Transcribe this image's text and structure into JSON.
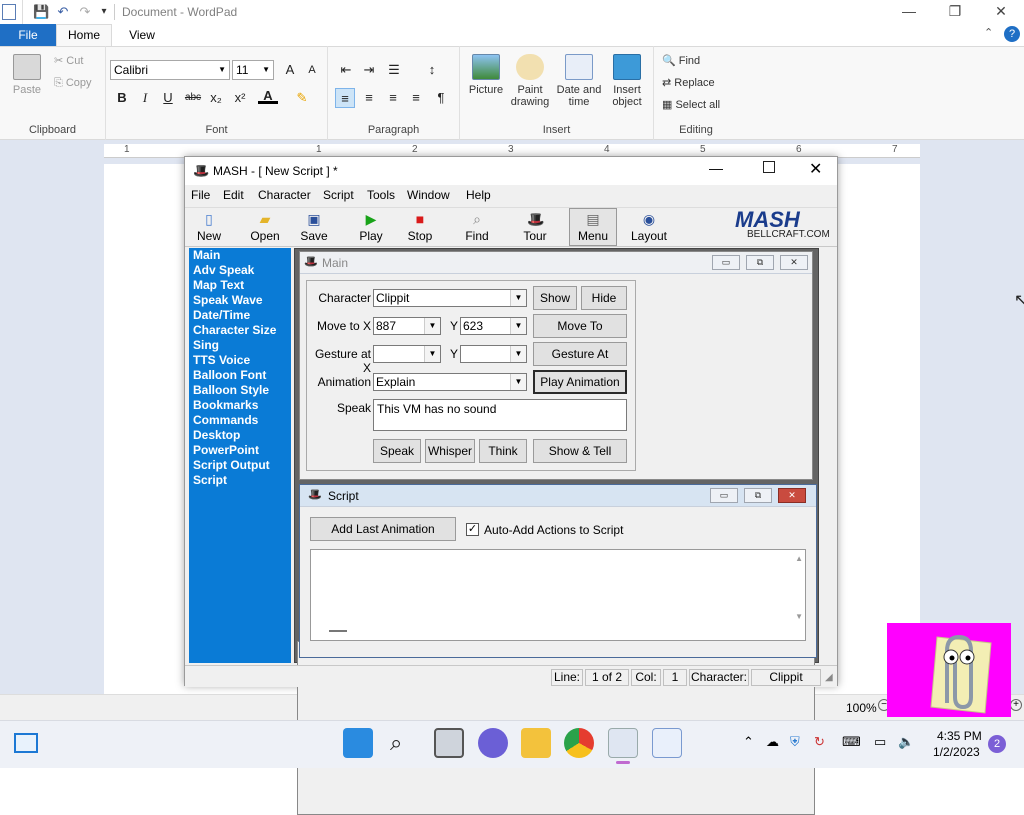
{
  "wordpad": {
    "title": "Document - WordPad",
    "tabs": {
      "file": "File",
      "home": "Home",
      "view": "View"
    },
    "clipboard": {
      "paste": "Paste",
      "cut": "Cut",
      "copy": "Copy",
      "group": "Clipboard"
    },
    "font": {
      "family": "Calibri",
      "size": "11",
      "group": "Font",
      "bold": "B",
      "italic": "I",
      "underline": "U",
      "strike": "abc",
      "sub": "x₂",
      "sup": "x²",
      "color": "A"
    },
    "paragraph": {
      "group": "Paragraph"
    },
    "insert": {
      "picture": "Picture",
      "paint": "Paint drawing",
      "datetime": "Date and time",
      "object": "Insert object",
      "group": "Insert"
    },
    "editing": {
      "find": "Find",
      "replace": "Replace",
      "select_all": "Select all",
      "group": "Editing"
    },
    "ruler": [
      "1",
      "1",
      "2",
      "3",
      "4",
      "5",
      "6",
      "7"
    ],
    "zoom": "100%"
  },
  "mash": {
    "title": "MASH - [ New Script ] *",
    "menu": [
      "File",
      "Edit",
      "Character",
      "Script",
      "Tools",
      "Window",
      "Help"
    ],
    "toolbar": {
      "new": "New",
      "open": "Open",
      "save": "Save",
      "play": "Play",
      "stop": "Stop",
      "find": "Find",
      "tour": "Tour",
      "menu": "Menu",
      "layout": "Layout"
    },
    "brand": "MASH",
    "brand_url": "BELLCRAFT.COM",
    "sidebar": [
      "Main",
      "Adv Speak",
      "Map Text",
      "Speak Wave",
      "Date/Time",
      "Character Size",
      "Sing",
      "TTS Voice",
      "Balloon Font",
      "Balloon Style",
      "Bookmarks",
      "Commands",
      "Desktop",
      "PowerPoint",
      "Script Output",
      "Script"
    ],
    "main": {
      "title": "Main",
      "character_label": "Character",
      "character": "Clippit",
      "show": "Show",
      "hide": "Hide",
      "moveto_label": "Move to X",
      "x": "887",
      "y_label": "Y",
      "y": "623",
      "moveto": "Move To",
      "gesture_label": "Gesture at X",
      "gesture_y_label": "Y",
      "gesture": "Gesture At",
      "animation_label": "Animation",
      "animation": "Explain",
      "play_animation": "Play Animation",
      "speak_label": "Speak",
      "speak_text": "This VM has no sound",
      "speak": "Speak",
      "whisper": "Whisper",
      "think": "Think",
      "showtell": "Show & Tell"
    },
    "script": {
      "title": "Script",
      "add_last": "Add Last Animation",
      "auto_add": "Auto-Add Actions to Script",
      "auto_add_checked": true
    },
    "status": {
      "line_label": "Line:",
      "line": "1 of 2",
      "col_label": "Col:",
      "col": "1",
      "char_label": "Character:",
      "char": "Clippit"
    }
  },
  "taskbar": {
    "time": "4:35 PM",
    "date": "1/2/2023",
    "badge": "2"
  }
}
